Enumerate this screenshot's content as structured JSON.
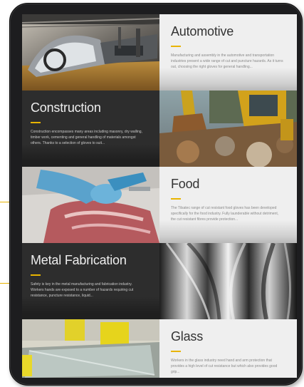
{
  "industries": [
    {
      "title": "Automotive",
      "description": "Manufacturing and assembly in the automotive and transportation industries present a wide range of cut and puncture hazards. As it turns out, choosing the right gloves for general handling...",
      "image": "automotive-assembly-line-photo"
    },
    {
      "title": "Construction",
      "description": "Construction encompasses many areas including masonry, dry walling, timber work, cementing and general handling of materials amongst others. Thanks to a selection of gloves to suit...",
      "image": "construction-excavator-photo"
    },
    {
      "title": "Food",
      "description": "The Tilsatec range of cut resistant food gloves has been developed specifically for the food industry. Fully launderable without detriment, the cut resistant fibres provide protection...",
      "image": "meat-cutting-gloved-hands-photo"
    },
    {
      "title": "Metal Fabrication",
      "description": "Safety is key in the metal manufacturing and fabrication industry. Workers hands are exposed to a number of hazards requiring cut resistance, puncture resistance, liquid...",
      "image": "metal-sheets-photo"
    },
    {
      "title": "Glass",
      "description": "Workers in the glass industry need hand and arm protection that provides a high level of cut resistance but which also provides good grip...",
      "image": "glass-handling-photo"
    }
  ],
  "colors": {
    "accent": "#e8b400",
    "light_panel": "#efefef",
    "dark_panel": "#2d2d2d",
    "tablet_frame": "#1d1d1f"
  }
}
